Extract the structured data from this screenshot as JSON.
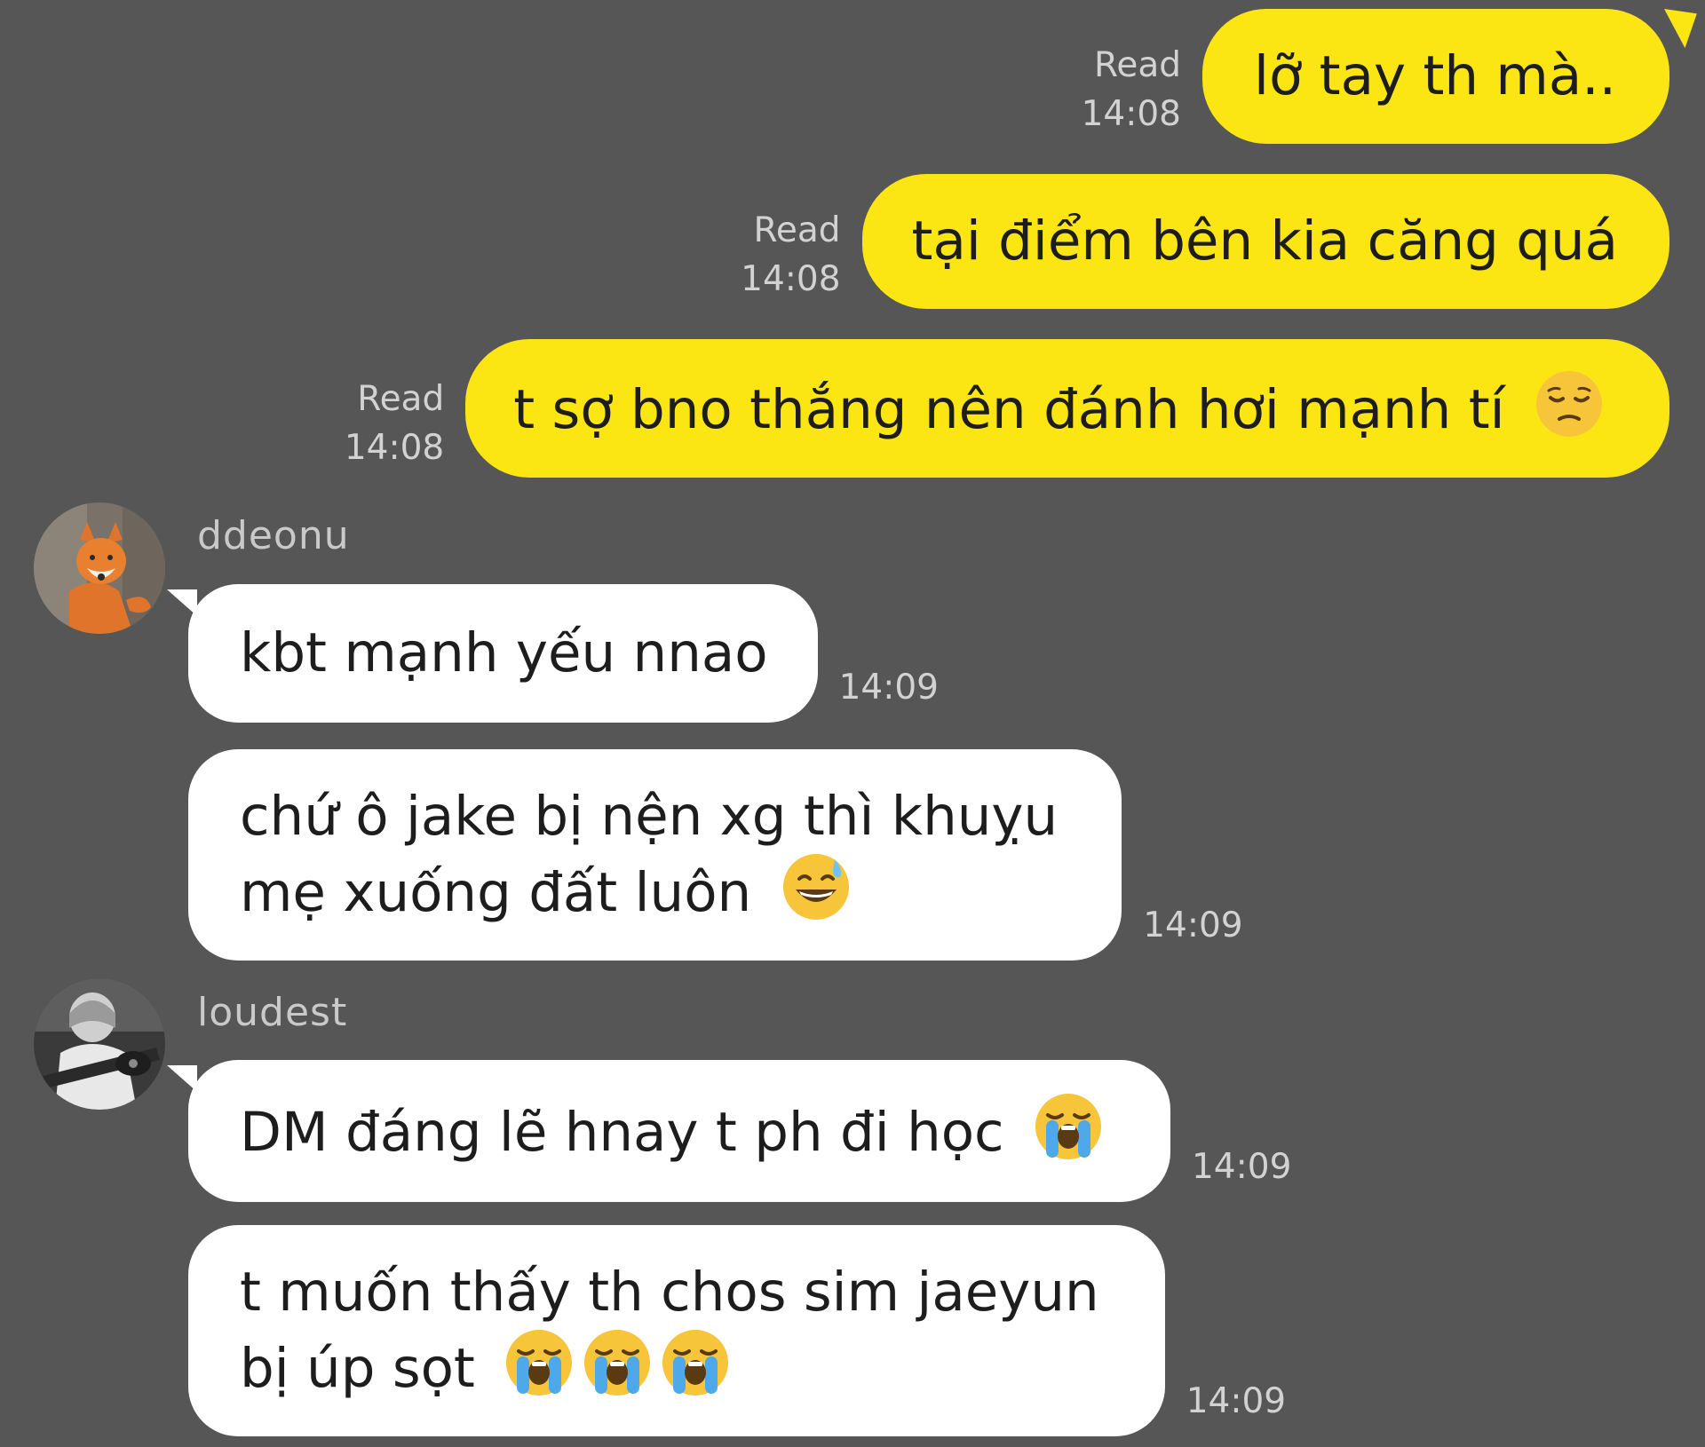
{
  "outgoing": [
    {
      "text": "lỡ tay th mà..",
      "status": "Read",
      "time": "14:08"
    },
    {
      "text": "tại điểm bên kia căng quá",
      "status": "Read",
      "time": "14:08"
    },
    {
      "text": "t sợ bno thắng nên đánh hơi mạnh tí",
      "emoji": "pensive-face",
      "status": "Read",
      "time": "14:08"
    }
  ],
  "groups": [
    {
      "sender": "ddeonu",
      "avatar": "fox-plush-avatar",
      "messages": [
        {
          "line1": "kbt mạnh yếu nnao",
          "time": "14:09"
        },
        {
          "line1": "chứ ô jake bị nện xg thì khuỵu",
          "line2": "mẹ xuống đất luôn",
          "emoji": "grinning-sweat-face",
          "time": "14:09"
        }
      ]
    },
    {
      "sender": "loudest",
      "avatar": "guitar-player-avatar",
      "messages": [
        {
          "line1": "DM đáng lẽ hnay t ph đi học",
          "emoji": "loudly-crying-face",
          "time": "14:09"
        },
        {
          "line1": "t muốn thấy th chos sim jaeyun",
          "line2": "bị úp sọt",
          "emoji": "loudly-crying-face x3",
          "time": "14:09"
        }
      ]
    }
  ],
  "colors": {
    "background": "#565656",
    "outgoing_bubble": "#fbe613",
    "incoming_bubble": "#ffffff",
    "meta_text": "#d2d2d2"
  }
}
